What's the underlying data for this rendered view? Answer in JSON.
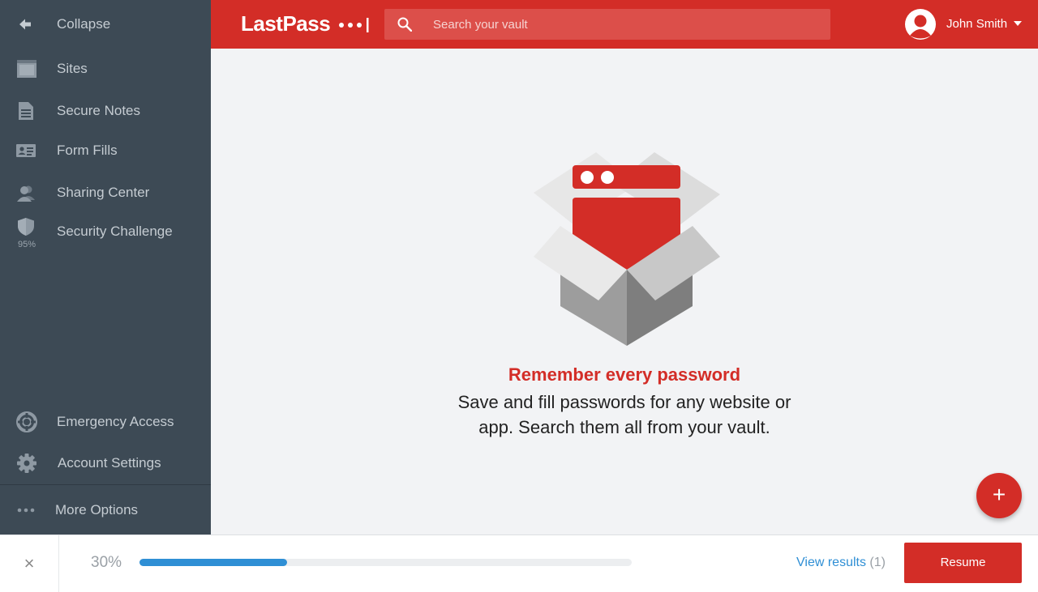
{
  "sidebar": {
    "collapse_label": "Collapse",
    "items": [
      {
        "label": "Sites",
        "icon": "browser-window-icon"
      },
      {
        "label": "Secure Notes",
        "icon": "document-icon"
      },
      {
        "label": "Form Fills",
        "icon": "id-card-icon"
      },
      {
        "label": "Sharing Center",
        "icon": "users-icon"
      },
      {
        "label": "Security Challenge",
        "icon": "shield-icon",
        "score": "95%"
      }
    ],
    "bottom_items": [
      {
        "label": "Emergency Access",
        "icon": "lifebuoy-icon"
      },
      {
        "label": "Account Settings",
        "icon": "gear-icon"
      },
      {
        "label": "More Options",
        "icon": "more-dots-icon"
      }
    ]
  },
  "header": {
    "logo_text": "LastPass",
    "search_placeholder": "Search your vault",
    "username": "John Smith"
  },
  "empty_state": {
    "title": "Remember every password",
    "description": "Save and fill passwords for any website or app. Search them all from your vault."
  },
  "fab_label": "+",
  "bottom_bar": {
    "close_label": "×",
    "progress_label": "30%",
    "progress_value": 0.3,
    "view_results_label": "View results",
    "view_results_count": "(1)",
    "resume_label": "Resume"
  },
  "colors": {
    "brand_red": "#d32d27",
    "sidebar_bg": "#3d4a55",
    "progress_blue": "#2f8fd5"
  }
}
